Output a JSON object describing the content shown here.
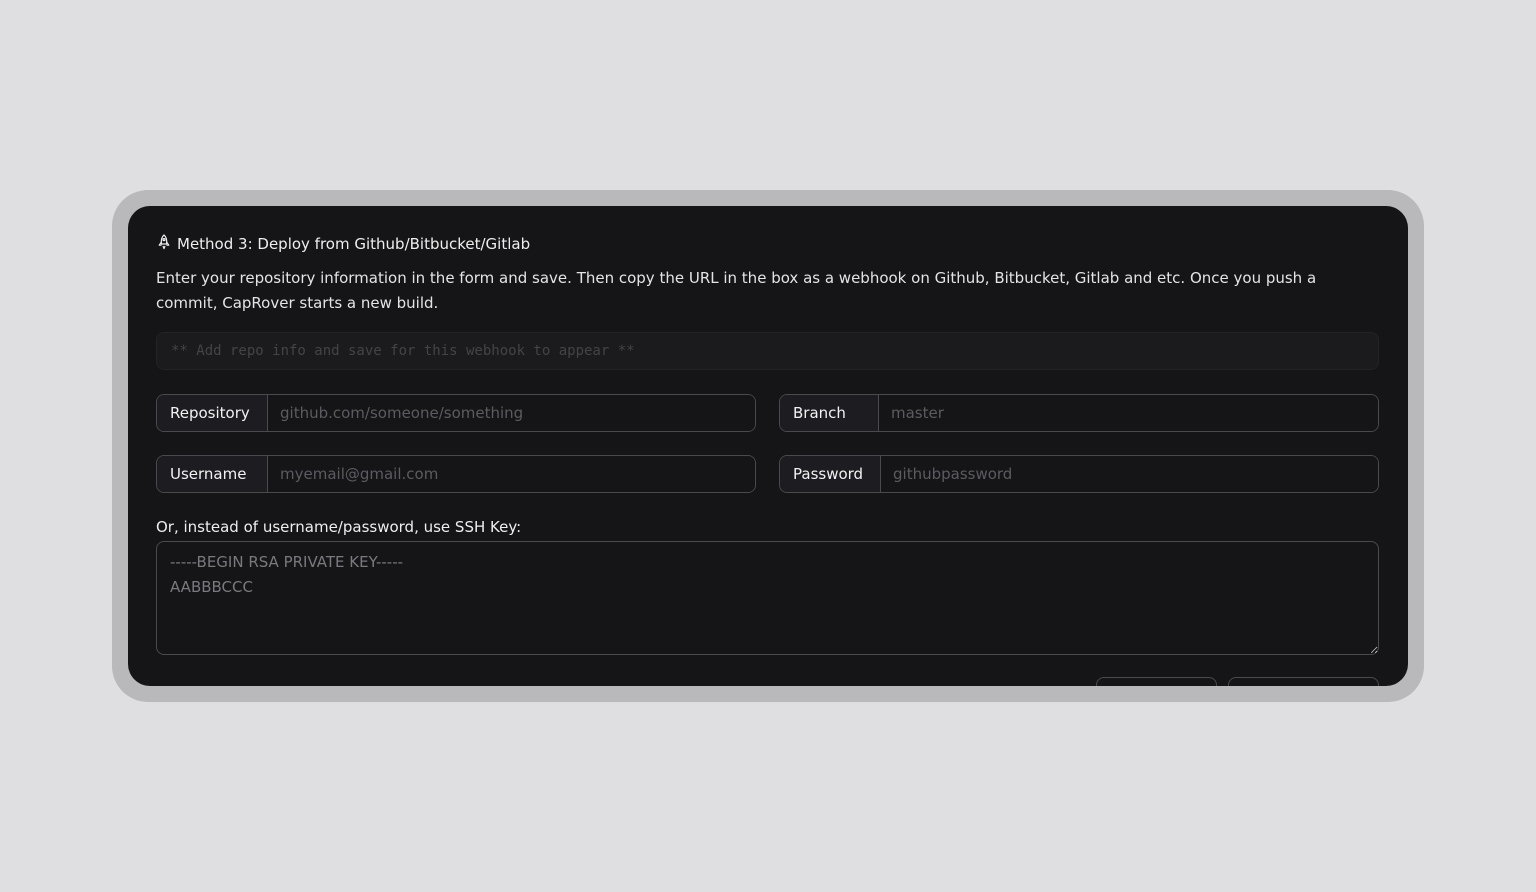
{
  "section": {
    "icon": "rocket-icon",
    "title": "Method 3: Deploy from Github/Bitbucket/Gitlab",
    "description": "Enter your repository information in the form and save. Then copy the URL in the box as a webhook on Github, Bitbucket, Gitlab and etc. Once you push a commit, CapRover starts a new build."
  },
  "webhook": {
    "placeholder": "** Add repo info and save for this webhook to appear **"
  },
  "form": {
    "repository": {
      "label": "Repository",
      "value": "",
      "placeholder": "github.com/someone/something"
    },
    "branch": {
      "label": "Branch",
      "value": "",
      "placeholder": "master"
    },
    "username": {
      "label": "Username",
      "value": "",
      "placeholder": "myemail@gmail.com"
    },
    "password": {
      "label": "Password",
      "value": "",
      "placeholder": "githubpassword"
    },
    "ssh": {
      "label": "Or, instead of username/password, use SSH Key:",
      "placeholder": "-----BEGIN RSA PRIVATE KEY-----\nAABBBCCC"
    }
  },
  "colors": {
    "page_background": "#dfdee0",
    "frame": "#b9b8bb",
    "panel_background": "#151417",
    "border": "#4a494d"
  }
}
